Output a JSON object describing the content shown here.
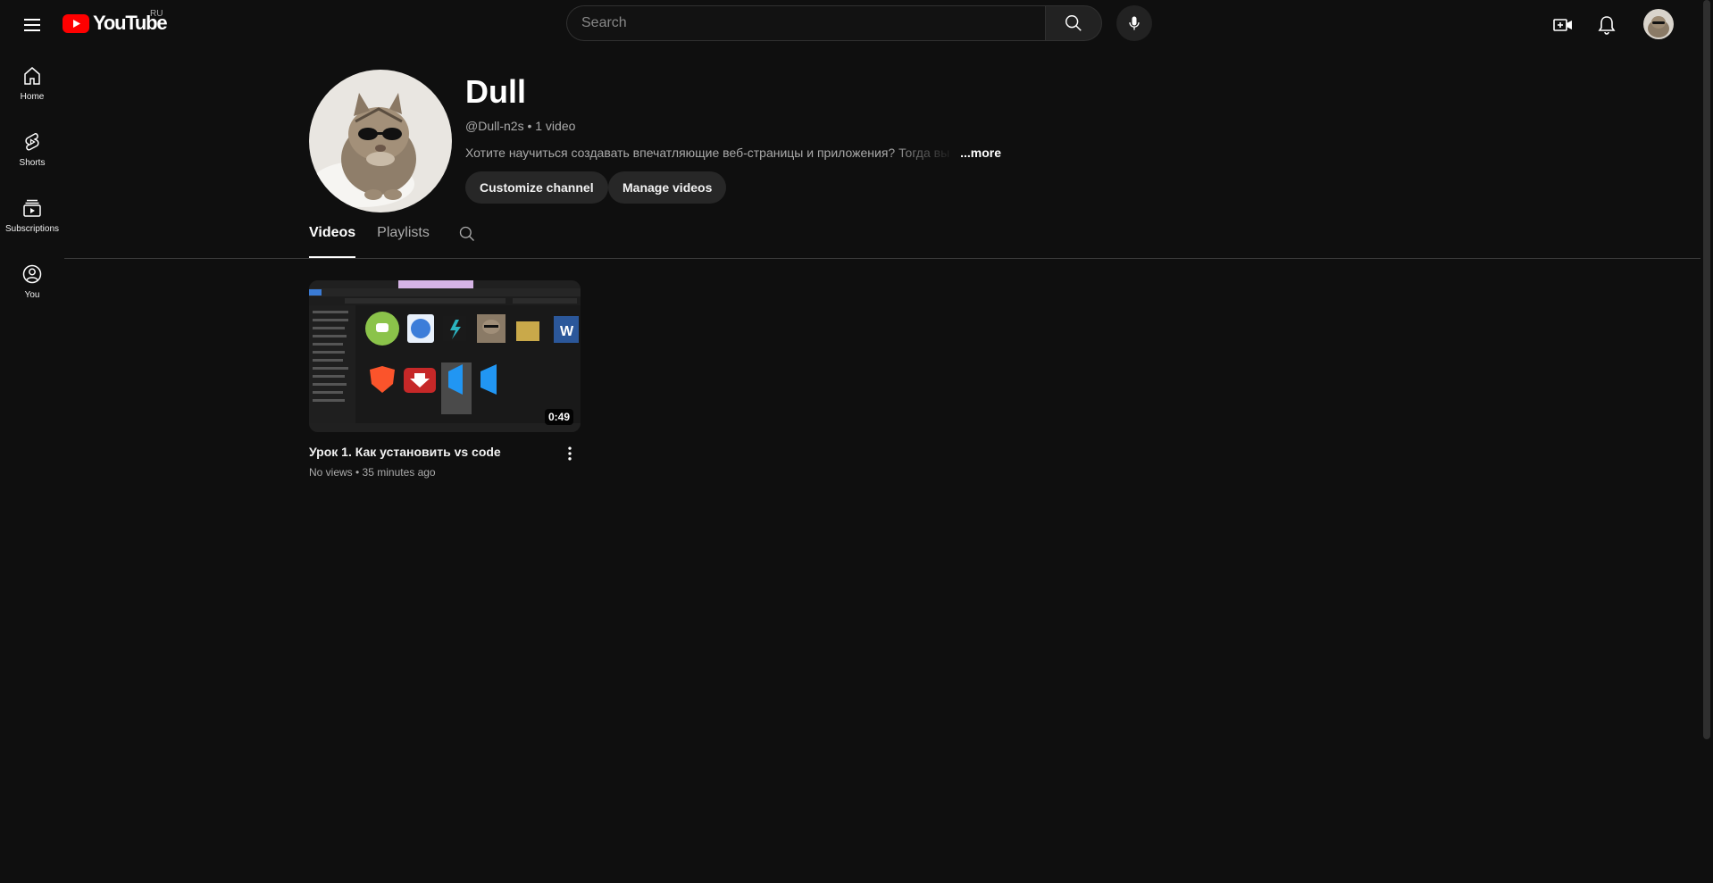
{
  "header": {
    "logo_text": "YouTube",
    "region": "RU",
    "search_placeholder": "Search"
  },
  "sidebar": {
    "items": [
      {
        "label": "Home",
        "icon": "home-icon"
      },
      {
        "label": "Shorts",
        "icon": "shorts-icon"
      },
      {
        "label": "Subscriptions",
        "icon": "subscriptions-icon"
      },
      {
        "label": "You",
        "icon": "you-icon"
      }
    ]
  },
  "channel": {
    "name": "Dull",
    "handle_line": "@Dull-n2s • 1 video",
    "description": "Хотите научиться создавать впечатляющие веб-страницы и приложения? Тогда вы",
    "more_label": "...more",
    "customize_label": "Customize channel",
    "manage_label": "Manage videos"
  },
  "tabs": [
    {
      "label": "Videos",
      "active": true
    },
    {
      "label": "Playlists",
      "active": false
    }
  ],
  "videos": [
    {
      "title": "Урок 1. Как установить vs code",
      "meta": "No views • 35 minutes ago",
      "duration": "0:49"
    }
  ],
  "colors": {
    "background": "#0f0f0f",
    "youtube_red": "#ff0000",
    "pill": "#272727"
  }
}
